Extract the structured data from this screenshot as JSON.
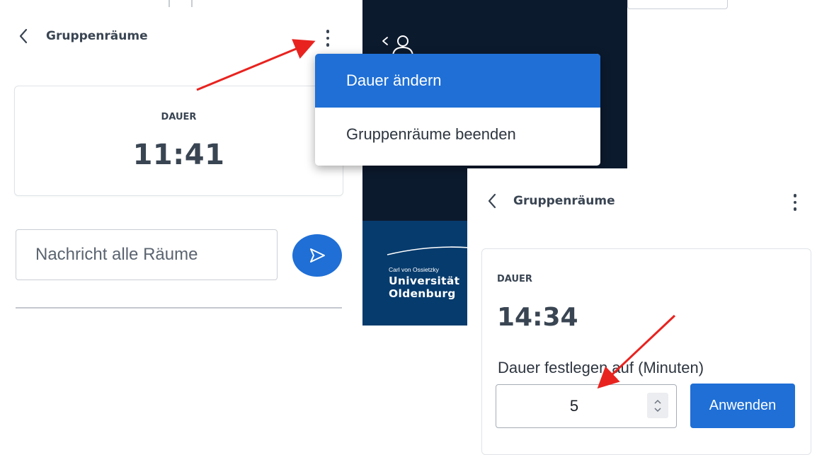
{
  "left_panel": {
    "header": {
      "title": "Gruppenräume"
    },
    "timer": {
      "label": "DAUER",
      "value": "11:41"
    },
    "message": {
      "placeholder": "Nachricht alle Räume"
    }
  },
  "menu": {
    "items": [
      {
        "label": "Dauer ändern",
        "active": true
      },
      {
        "label": "Gruppenräume beenden",
        "active": false
      }
    ]
  },
  "logo": {
    "small": "Carl von Ossietzky",
    "line1": "Universität",
    "line2": "Oldenburg"
  },
  "right_panel": {
    "header": {
      "title": "Gruppenräume"
    },
    "timer": {
      "label": "DAUER",
      "value": "14:34"
    },
    "duration_label": "Dauer festlegen auf (Minuten)",
    "minutes_value": "5",
    "apply_label": "Anwenden"
  },
  "colors": {
    "primary": "#1f6fd6",
    "dark_bg": "#0c1a2e",
    "uni_blue": "#063b6d",
    "annotation_arrow": "#e8231f"
  },
  "icons": [
    "chevron-left-icon",
    "kebab-menu-icon",
    "send-icon",
    "users-icon",
    "spinner-up-icon",
    "spinner-down-icon"
  ]
}
